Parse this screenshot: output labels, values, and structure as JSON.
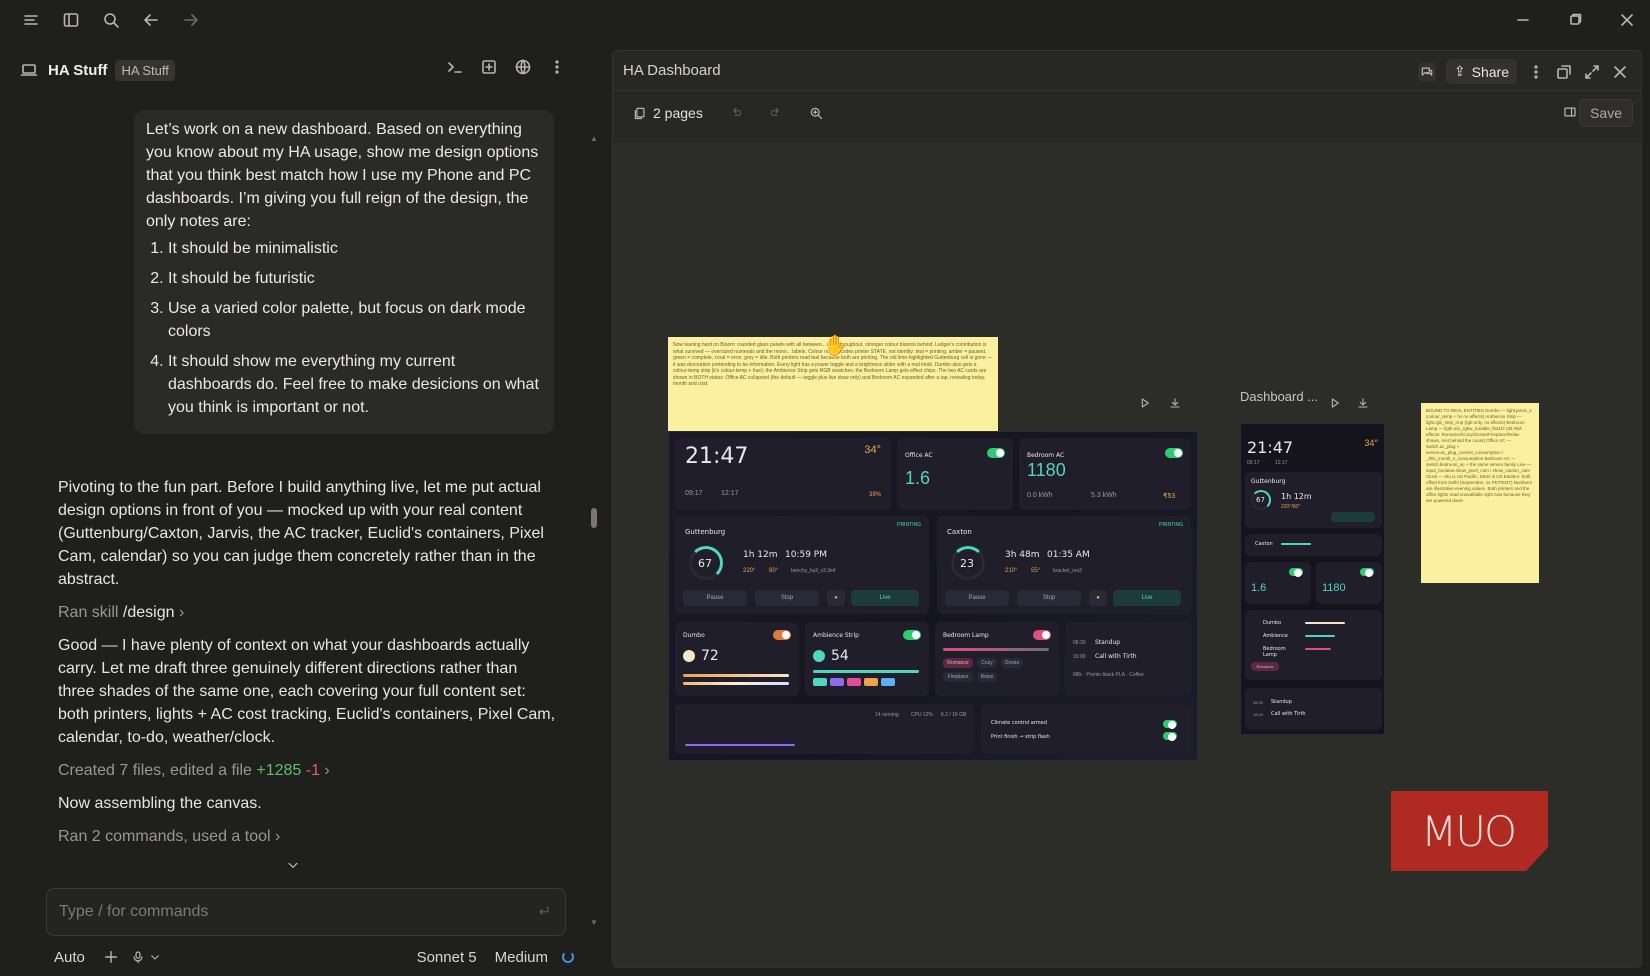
{
  "left": {
    "project_name": "HA Stuff",
    "project_badge": "HA Stuff",
    "user_message": {
      "intro": "Let’s work on a new dashboard. Based on everything you know about my HA usage, show me design options that you think best match how I use my Phone and PC dashboards. I’m giving you full reign of the design, the only notes are:",
      "items": [
        "It should be minimalistic",
        "It should be futuristic",
        "Use a varied color palette, but focus on dark mode colors",
        "It should show me everything my current dashboards do. Feel free to make desicions on what you think is important or not."
      ]
    },
    "assistant": {
      "p1": "Pivoting to the fun part. Before I build anything live, let me put actual design options in front of you — mocked up with your real content (Guttenburg/Caxton, Jarvis, the AC tracker, Euclid's containers, Pixel Cam, calendar) so you can judge them concretely rather than in the abstract.",
      "skill_prefix": "Ran skill ",
      "skill_name": "/design",
      "p2": "Good — I have plenty of context on what your dashboards actually carry. Let me draft three genuinely different directions rather than three shades of the same one, each covering your full content set: both printers, lights + AC cost tracking, Euclid's containers, Pixel Cam, calendar, to-do, weather/clock.",
      "files_text": "Created 7 files, edited a file ",
      "files_plus": "+1285",
      "files_minus": "-1",
      "p3": "Now assembling the canvas.",
      "commands_text": "Ran 2 commands, used a tool"
    },
    "input_placeholder": "Type / for commands",
    "mode": "Auto",
    "model": "Sonnet 5",
    "effort": "Medium"
  },
  "right": {
    "title": "HA Dashboard",
    "share_label": "Share",
    "pages_label": "2 pages",
    "save_label": "Save",
    "frame2_label": "Dashboard ...",
    "main": {
      "clock": "21:47",
      "temp": "34°",
      "t1": "09:17",
      "t2": "12:17",
      "humidity": "39%",
      "office_ac_label": "Office AC",
      "office_ac_value": "1.6",
      "bedroom_ac_label": "Bedroom AC",
      "bedroom_ac_value": "1180",
      "bedroom_ac_kwh": "0.0 kWh",
      "bedroom_ac_kwh2": "5.3 kWh",
      "bedroom_ac_cost": "₹53",
      "printer1_name": "Guttenburg",
      "printer1_pct": "67",
      "printer1_time": "1h 12m",
      "printer1_eta": "10:59 PM",
      "printer1_temp1": "220°",
      "printer1_temp2": "60°",
      "printer1_file": "benchy_hull_v3.3mf",
      "printer1_state": "PRINTING",
      "printer2_name": "Caxton",
      "printer2_pct": "23",
      "printer2_time": "3h 48m",
      "printer2_eta": "01:35 AM",
      "printer2_temp1": "210°",
      "printer2_temp2": "55°",
      "printer2_file": "bracket_rev2",
      "printer2_state": "PRINTING",
      "pause": "Pause",
      "stop": "Stop",
      "live": "Live",
      "dumbo_label": "Dumbo",
      "dumbo_value": "72",
      "ambience_label": "Ambience Strip",
      "ambience_value": "54",
      "bedroom_lamp_label": "Bedroom Lamp",
      "scene1": "Romance",
      "scene2": "Cozy",
      "scene3": "Ocean",
      "scene4": "Fireplace",
      "scene5": "Relax",
      "event1_time": "08:30",
      "event1": "Standup",
      "event2_time": "16:00",
      "event2": "Call with Tirth",
      "event_note": "Milk · Pronto black PLA · Coffee",
      "containers_status": "14 running",
      "cpu": "CPU 12%",
      "mem": "6.2 / 16 GB",
      "todo1": "Climate control armed",
      "todo2": "Print finish → strip flash"
    },
    "phone": {
      "clock": "21:47",
      "temp": "34°",
      "t1": "09:17",
      "t2": "12:17",
      "printer_name": "Guttenburg",
      "printer_pct": "67",
      "printer_time": "1h 12m",
      "printer_temps": "220°/60°",
      "printer2_name": "Caxton",
      "ac1": "1.6",
      "ac2": "1180",
      "light1": "Dumbo",
      "light2": "Ambience",
      "light3": "Bedroom Lamp",
      "scene": "Romance",
      "event1_time": "08:30",
      "event1": "Standup",
      "event2_time": "16:00",
      "event2": "Call with Tirth"
    },
    "note1": "Now leaning hard on Bloom: rounded glass panels with all between... intra throughout, stronger colour blooms behind. Ledger's contribution is what survived — oversized numerals and the mono... labels. Colour now encodes printer STATE, not identity: teal = printing, amber = paused, green = complete, coral = error, grey = idle. Both printers read teal because both are printing. The old lime-highlighted Guttenburg cell is gone — it was decoration pretending to be information. Every light has a power toggle and a brightness slider with a real knob. Dumbo also gets a colour-temp strip (it's colour-temp + hue); the Ambience Strip gets RGB swatches; the Bedroom Lamp gets effect chips. The two AC cards are shown in BOTH states: Office AC collapsed (the default — toggle plus live draw only) and Bedroom AC expanded after a tap, revealing today, month and cost.",
    "note2": "BOUND TO REAL ENTITIES Dumbo — light.jarvis_2 (colour_temp + hs no effects) Ambience Strip — light.rgb_strip_rmp (rgb only, no effects) Bedroom Lamp — light.wiz_rgbw_tunable_f6a1f2 (35 WiZ effects: Romance/Cozy/Ocean/Fireplace/Relax shown, rest behind the count) Office AC — switch.ac_plug + sensor.ac_plug_current_consumption / _this_month_s_consumption Bedroom AC — switch.bedroom_ac + the same sensor family Live — input_boolean.show_pixel_cam / show_caxton_cam Clock — Stu is US Pacific, MUO is US Eastern: both offset from Delhi (September, so PDT/EDT) Numbers are illustrative evening values. Both printers and the office lights read unavailable right now because they are powered down",
    "watermark": "MUO"
  }
}
